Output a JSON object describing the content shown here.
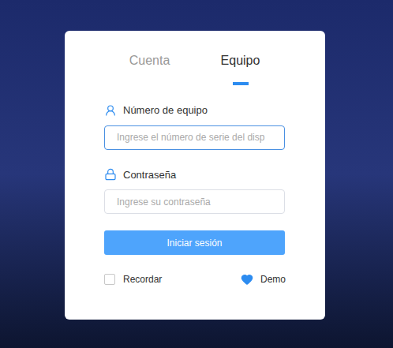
{
  "tabs": [
    {
      "label": "Cuenta",
      "selected": false
    },
    {
      "label": "Equipo",
      "selected": true
    }
  ],
  "fields": [
    {
      "label": "Número de equipo",
      "placeholder": "Ingrese el número de serie del disp",
      "focused": true,
      "kind": "device"
    },
    {
      "label": "Contraseña",
      "placeholder": "Ingrese su contraseña",
      "focused": false,
      "kind": "password"
    }
  ],
  "login_button": "Iniciar sesión",
  "remember": {
    "label": "Recordar",
    "checked": false
  },
  "demo": "Demo"
}
